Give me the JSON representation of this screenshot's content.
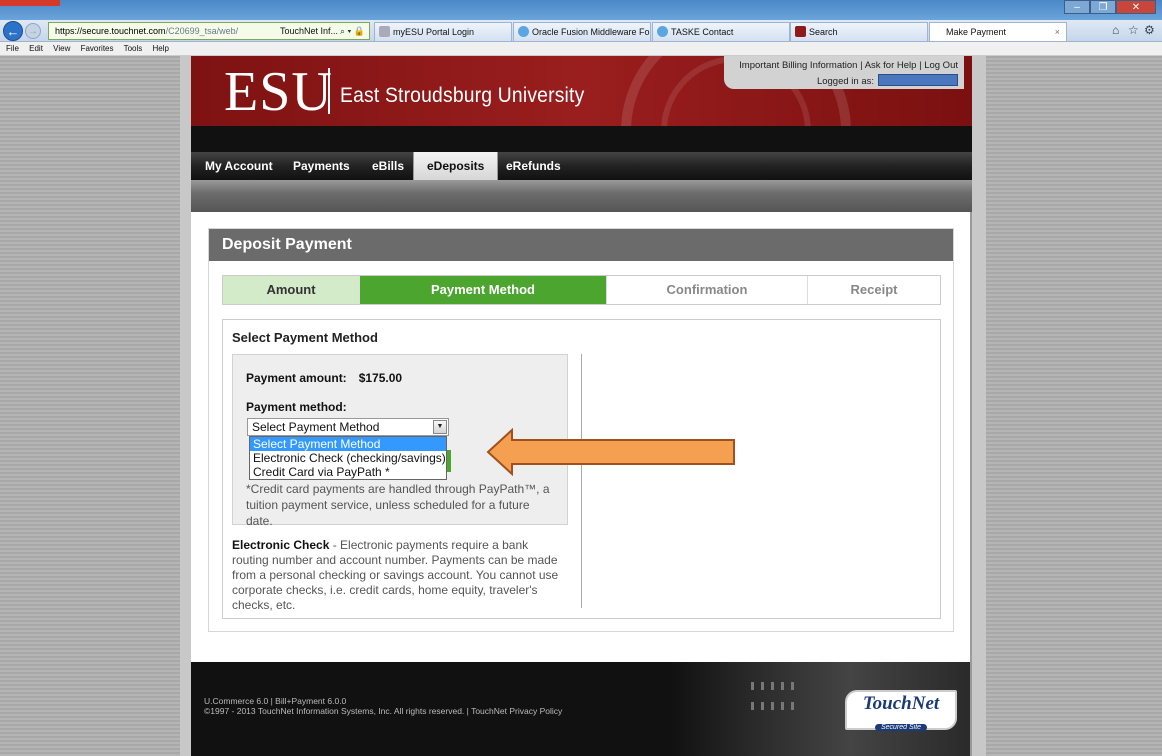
{
  "browser": {
    "address_host": "https://secure.touchnet.com",
    "address_path": "/C20699_tsa/web/",
    "tabs": [
      {
        "label": "TouchNet Inf..."
      },
      {
        "label": "myESU Portal Login"
      },
      {
        "label": "Oracle Fusion Middleware For..."
      },
      {
        "label": "TASKE Contact"
      },
      {
        "label": "Search"
      },
      {
        "label": "Make Payment"
      }
    ],
    "menu": [
      "File",
      "Edit",
      "View",
      "Favorites",
      "Tools",
      "Help"
    ]
  },
  "header": {
    "logo": "ESU",
    "university": "East Stroudsburg University",
    "links": [
      "Important Billing Information",
      "Ask for Help",
      "Log Out"
    ],
    "logged_in_label": "Logged in as:"
  },
  "nav": {
    "tabs": [
      "My Account",
      "Payments",
      "eBills",
      "eDeposits",
      "eRefunds"
    ],
    "active": "eDeposits"
  },
  "panel": {
    "title": "Deposit Payment",
    "steps": [
      "Amount",
      "Payment Method",
      "Confirmation",
      "Receipt"
    ],
    "section_title": "Select Payment Method",
    "payment_amount_label": "Payment amount:",
    "payment_amount_value": "$175.00",
    "payment_method_label": "Payment method:",
    "select_value": "Select Payment Method",
    "options": [
      "Select Payment Method",
      "Electronic Check (checking/savings)",
      "Credit Card via PayPath *"
    ],
    "credit_note": "*Credit card payments are handled through PayPath™, a tuition payment service, unless scheduled for a future date.",
    "echeck_title": "Electronic Check",
    "echeck_text": " - Electronic payments require a bank routing number and account number. Payments can be made from a personal checking or savings account. You cannot use corporate checks, i.e. credit cards, home equity, traveler's checks, etc."
  },
  "footer": {
    "line1": "U.Commerce 6.0 | Bill+Payment 6.0.0",
    "line2": "©1997 - 2013 TouchNet Information Systems, Inc. All rights reserved. | TouchNet Privacy Policy",
    "logo": "TouchNet",
    "logo_sub": "Secured Site"
  },
  "colors": {
    "esu_red": "#8e1a1a",
    "step_green": "#4ca52f",
    "arrow_orange": "#f4a050"
  }
}
